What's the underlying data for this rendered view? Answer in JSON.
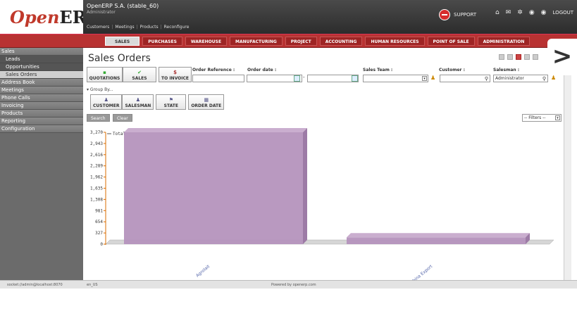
{
  "header": {
    "logo_open": "Open",
    "logo_erp": "ERP",
    "company": "OpenERP S.A. (stable_60)",
    "user": "Administrator",
    "shortcuts": [
      "Customers",
      "Meetings",
      "Products",
      "Reconfigure"
    ],
    "support_label": "SUPPORT",
    "logout_label": "LOGOUT"
  },
  "menu": [
    "SALES",
    "PURCHASES",
    "WAREHOUSE",
    "MANUFACTURING",
    "PROJECT",
    "ACCOUNTING",
    "HUMAN RESOURCES",
    "POINT OF SALE",
    "ADMINISTRATION"
  ],
  "sidebar": {
    "sales": "Sales",
    "sales_items": [
      "Leads",
      "Opportunities",
      "Sales Orders"
    ],
    "categories": [
      "Address Book",
      "Meetings",
      "Phone Calls",
      "Invoicing",
      "Products",
      "Reporting",
      "Configuration"
    ]
  },
  "main": {
    "title": "Sales Orders",
    "filter_buttons": [
      "QUOTATIONS",
      "SALES",
      "TO INVOICE"
    ],
    "labels": {
      "order_ref": "Order Reference :",
      "order_date": "Order date :",
      "sales_team": "Sales Team :",
      "customer": "Customer :",
      "salesman": "Salesman :"
    },
    "salesman_value": "Administrator",
    "date_sep": "-",
    "group_by": "▾ Group By...",
    "group_buttons": [
      "CUSTOMER",
      "SALESMAN",
      "STATE",
      "ORDER DATE"
    ],
    "search_btn": "Search",
    "clear_btn": "Clear",
    "filters_select": "-- Filters --"
  },
  "chart_data": {
    "type": "bar",
    "categories": [
      "Agrolait",
      "China Export"
    ],
    "series": [
      {
        "name": "Total",
        "values": [
          3270,
          200
        ]
      }
    ],
    "yticks": [
      "0",
      "327",
      "654",
      "981",
      "1,308",
      "1,635",
      "1,962",
      "2,289",
      "2,616",
      "2,943",
      "3,270"
    ],
    "ylim": [
      0,
      3270
    ],
    "legend_position": "top-left",
    "bar_color": "#b594bd"
  },
  "footer": {
    "socket": "socket://admin@localhost:8070",
    "lang": "en_US",
    "powered": "Powered by openerp.com"
  }
}
